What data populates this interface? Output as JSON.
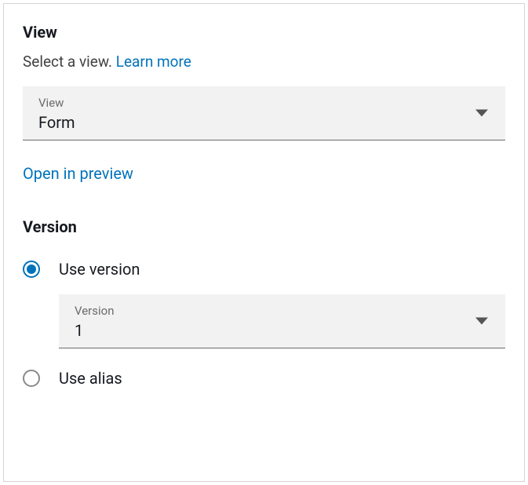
{
  "view": {
    "heading": "View",
    "subtext": "Select a view. ",
    "learn_more": "Learn more",
    "select_label": "View",
    "select_value": "Form",
    "preview_link": "Open in preview"
  },
  "version": {
    "heading": "Version",
    "use_version_label": "Use version",
    "use_alias_label": "Use alias",
    "version_select_label": "Version",
    "version_select_value": "1",
    "selected_option": "use_version"
  }
}
